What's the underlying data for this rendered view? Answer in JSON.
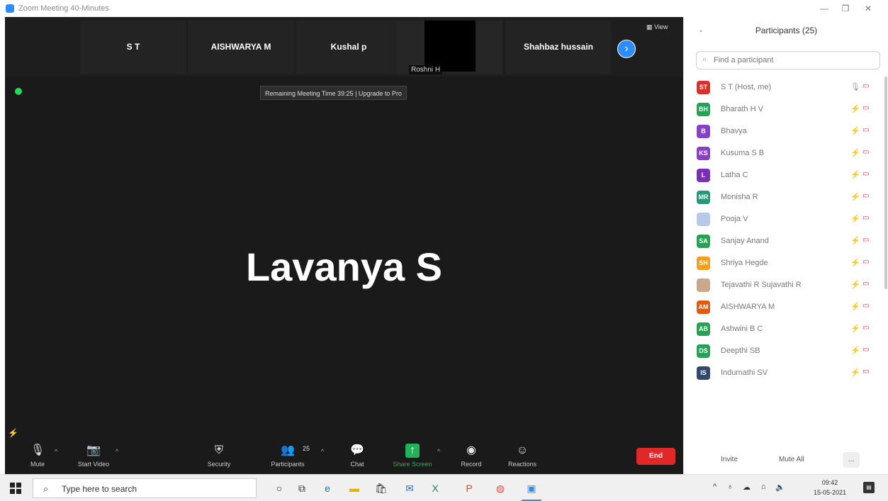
{
  "window": {
    "title": "Zoom Meeting 40-Minutes"
  },
  "gallery": {
    "tiles": [
      {
        "name": "S T"
      },
      {
        "name": "AISHWARYA M"
      },
      {
        "name": "Kushal p"
      },
      {
        "name": "Roshni H",
        "video": true
      },
      {
        "name": "Shahbaz hussain"
      }
    ],
    "view_label": "View"
  },
  "banner": {
    "text": "Remaining Meeting Time 39:25 | Upgrade to Pro"
  },
  "active_speaker": {
    "name": "Lavanya S"
  },
  "toolbar": {
    "mute": "Mute",
    "start_video": "Start Video",
    "security": "Security",
    "participants": "Participants",
    "participants_count": "25",
    "chat": "Chat",
    "share_screen": "Share Screen",
    "record": "Record",
    "reactions": "Reactions",
    "end": "End"
  },
  "panel": {
    "title": "Participants (25)",
    "search_placeholder": "Find a participant",
    "participants": [
      {
        "initials": "ST",
        "name": "S T (Host, me)",
        "color": "#d9302c",
        "host": true
      },
      {
        "initials": "BH",
        "name": "Bharath H V",
        "color": "#23a455"
      },
      {
        "initials": "B",
        "name": "Bhavya",
        "color": "#8a3fc7"
      },
      {
        "initials": "KS",
        "name": "Kusuma S B",
        "color": "#8a3fc7"
      },
      {
        "initials": "L",
        "name": "Latha C",
        "color": "#7b2fb5"
      },
      {
        "initials": "MR",
        "name": "Monisha R",
        "color": "#1f9c7a"
      },
      {
        "initials": "",
        "name": "Pooja V",
        "color": "#b8c8e8"
      },
      {
        "initials": "SA",
        "name": "Sanjay Anand",
        "color": "#23a455"
      },
      {
        "initials": "SH",
        "name": "Shriya Hegde",
        "color": "#f0a020"
      },
      {
        "initials": "",
        "name": "Tejavathi R Sujavathi R",
        "color": "#caa88a"
      },
      {
        "initials": "AM",
        "name": "AISHWARYA M",
        "color": "#e05a10"
      },
      {
        "initials": "AB",
        "name": "Ashwini B C",
        "color": "#23a455"
      },
      {
        "initials": "DS",
        "name": "Deepthi SB",
        "color": "#23a455"
      },
      {
        "initials": "IS",
        "name": "Indumathi SV",
        "color": "#2f4a6e"
      }
    ],
    "invite": "Invite",
    "mute_all": "Mute All",
    "more": "..."
  },
  "taskbar": {
    "search_placeholder": "Type here to search",
    "time": "09:42",
    "date": "15-05-2021"
  }
}
